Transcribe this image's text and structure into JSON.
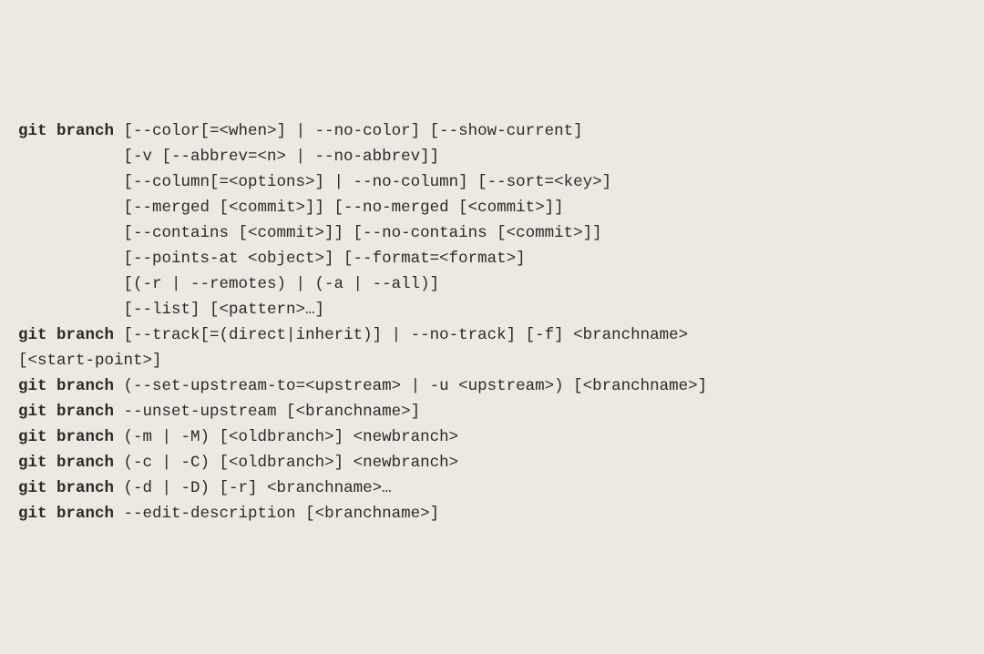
{
  "synopsis": {
    "form1": {
      "cmd": "git branch",
      "line1": " [--color[=<when>] | --no-color] [--show-current]",
      "line2": "           [-v [--abbrev=<n> | --no-abbrev]]",
      "line3": "           [--column[=<options>] | --no-column] [--sort=<key>]",
      "line4": "           [--merged [<commit>]] [--no-merged [<commit>]]",
      "line5": "           [--contains [<commit>]] [--no-contains [<commit>]]",
      "line6": "           [--points-at <object>] [--format=<format>]",
      "line7": "           [(-r | --remotes) | (-a | --all)]",
      "line8": "           [--list] [<pattern>…]"
    },
    "form2": {
      "cmd": "git branch",
      "line1": " [--track[=(direct|inherit)] | --no-track] [-f] <branchname>",
      "line2": "[<start-point>]"
    },
    "form3": {
      "cmd": "git branch",
      "rest": " (--set-upstream-to=<upstream> | -u <upstream>) [<branchname>]"
    },
    "form4": {
      "cmd": "git branch",
      "rest": " --unset-upstream [<branchname>]"
    },
    "form5": {
      "cmd": "git branch",
      "rest": " (-m | -M) [<oldbranch>] <newbranch>"
    },
    "form6": {
      "cmd": "git branch",
      "rest": " (-c | -C) [<oldbranch>] <newbranch>"
    },
    "form7": {
      "cmd": "git branch",
      "rest": " (-d | -D) [-r] <branchname>…"
    },
    "form8": {
      "cmd": "git branch",
      "rest": " --edit-description [<branchname>]"
    }
  }
}
